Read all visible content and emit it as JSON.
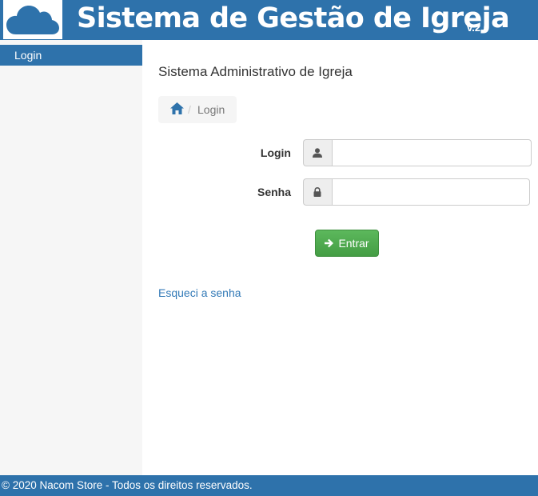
{
  "header": {
    "logo_icon": "cloud-icon",
    "title": "Sistema de Gestão de Igreja",
    "version": "v.2.0",
    "background_color": "#2e72ab"
  },
  "sidebar": {
    "items": [
      {
        "label": "Login",
        "active": true
      }
    ]
  },
  "main": {
    "page_title": "Sistema Administrativo de Igreja",
    "breadcrumb": {
      "home_icon": "home-icon",
      "separator": "/",
      "current": "Login"
    },
    "form": {
      "login_label": "Login",
      "login_icon": "user-icon",
      "login_value": "",
      "senha_label": "Senha",
      "senha_icon": "lock-icon",
      "senha_value": "",
      "submit_label": "Entrar",
      "submit_icon": "arrow-right-icon",
      "submit_color": "#5cb85c"
    },
    "forgot_password": "Esqueci a senha"
  },
  "footer": {
    "text": "© 2020 Nacom Store - Todos os direitos reservados."
  }
}
